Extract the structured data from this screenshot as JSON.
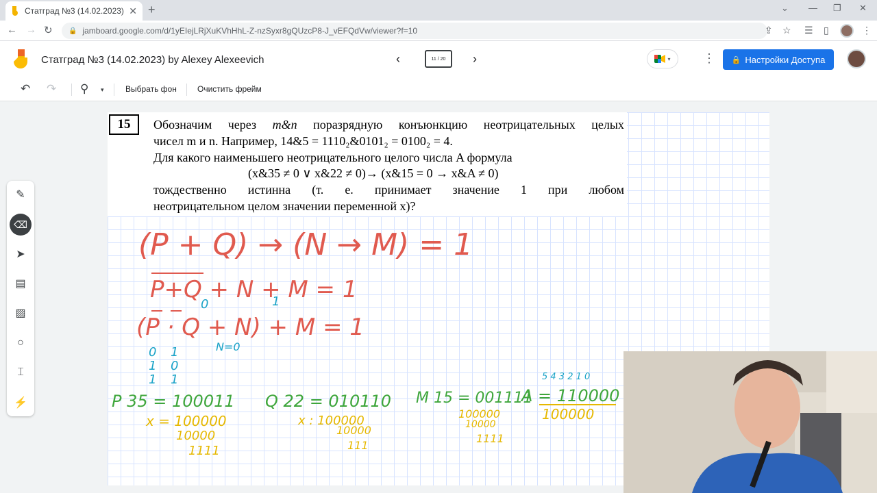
{
  "browser": {
    "tab_title": "Статград №3 (14.02.2023) by Ale",
    "tab_close": "✕",
    "new_tab": "+",
    "url": "jamboard.google.com/d/1yEIejLRjXuKVhHhL-Z-nzSyxr8gQUzcP8-J_vEFQdVw/viewer?f=10"
  },
  "app": {
    "title": "Статград №3 (14.02.2023) by Alexey Alexeevich",
    "frame_indicator": "11 / 20",
    "share_button": "Настройки Доступа"
  },
  "toolbar": {
    "set_background": "Выбрать фон",
    "clear_frame": "Очистить фрейм"
  },
  "problem": {
    "number": "15",
    "line1": [
      "Обозначим",
      "через",
      "m&n",
      "поразрядную",
      "конъюнкцию",
      "неотрицательных",
      "целых"
    ],
    "line2": "чисел m и n.  Например, 14&5 = 1110₂&0101₂ = 0100₂ = 4.",
    "line3": "Для какого наименьшего неотрицательного целого числа A формула",
    "formula": "(x&35 ≠ 0 ∨ x&22 ≠ 0)→ (x&15 = 0 → x&A ≠ 0)",
    "line5": [
      "тождественно",
      "истинна",
      "(т.",
      "е.",
      "принимает",
      "значение",
      "1",
      "при",
      "любом"
    ],
    "line6": "неотрицательном целом значении переменной x)?"
  },
  "handwriting": {
    "h1": "(P + Q) → (N → M) = 1",
    "h2": "P+Q + N + M = 1",
    "h2_sub": "0",
    "h2_n": "1",
    "h3": "(P · Q + N) + M = 1",
    "h3_n0": "N=0",
    "col_p": [
      "0",
      "1",
      "1"
    ],
    "col_q": [
      "1",
      "0",
      "1"
    ],
    "p35": "P 35 = 100011",
    "x_p": "x = 100000",
    "x_p2": "10000",
    "x_p3": "1111",
    "q22": "Q 22 = 010110",
    "x_q": "x : 100000",
    "x_q2": "10000",
    "x_q3": "111",
    "m15": "M 15 = 001111",
    "m_a": "100000",
    "m_b": "10000",
    "m_c": "1111",
    "a_bits": "5 4 3 2 1 0",
    "a_val": "A = 110000",
    "a_line2": "100000"
  },
  "colors": {
    "accent": "#1a73e8",
    "red_ink": "#e05a4f",
    "green_ink": "#3fa63c",
    "cyan_ink": "#1aa3c7",
    "yellow_ink": "#e6b800"
  }
}
